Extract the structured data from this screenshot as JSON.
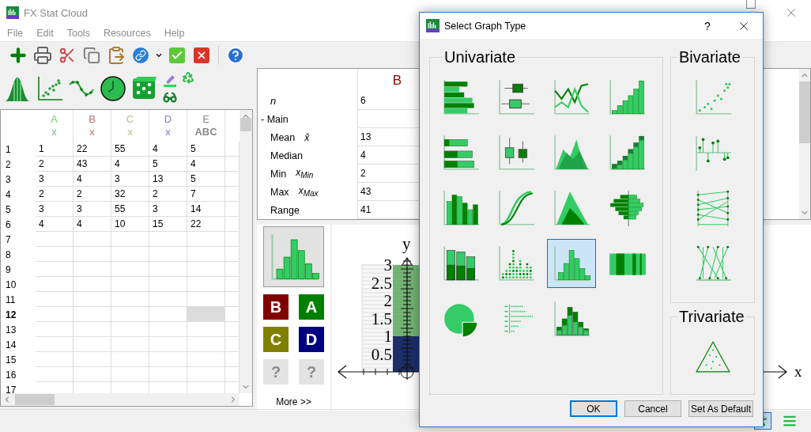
{
  "window": {
    "title": "FX Stat Cloud"
  },
  "menu": [
    "File",
    "Edit",
    "Tools",
    "Resources",
    "Help"
  ],
  "spreadsheet": {
    "columns": [
      {
        "letter": "A",
        "type": "x",
        "color": "#80c080"
      },
      {
        "letter": "B",
        "type": "x",
        "color": "#c07070"
      },
      {
        "letter": "C",
        "type": "x",
        "color": "#c0c080"
      },
      {
        "letter": "D",
        "type": "x",
        "color": "#8080c0"
      },
      {
        "letter": "E",
        "type": "ABC",
        "color": "#8a8a8a"
      }
    ],
    "rows": [
      {
        "label": "1",
        "current": false,
        "cells": [
          "1",
          "22",
          "55",
          "4",
          "5"
        ]
      },
      {
        "label": "2",
        "current": false,
        "cells": [
          "2",
          "43",
          "4",
          "5",
          "4"
        ]
      },
      {
        "label": "3",
        "current": false,
        "cells": [
          "3",
          "4",
          "3",
          "13",
          "5"
        ]
      },
      {
        "label": "4",
        "current": false,
        "cells": [
          "2",
          "2",
          "32",
          "2",
          "7"
        ]
      },
      {
        "label": "5",
        "current": false,
        "cells": [
          "3",
          "3",
          "55",
          "3",
          "14"
        ]
      },
      {
        "label": "6",
        "current": false,
        "cells": [
          "4",
          "4",
          "10",
          "15",
          "22"
        ]
      },
      {
        "label": "7",
        "current": false
      },
      {
        "label": "8",
        "current": false
      },
      {
        "label": "9",
        "current": false
      },
      {
        "label": "10",
        "current": false
      },
      {
        "label": "11",
        "current": false
      },
      {
        "label": "12",
        "current": true,
        "selected_cells": [
          false,
          false,
          false,
          false,
          true
        ]
      },
      {
        "label": "13",
        "current": false
      },
      {
        "label": "14",
        "current": false
      },
      {
        "label": "15",
        "current": false
      },
      {
        "label": "16",
        "current": false
      },
      {
        "label": "17",
        "current": false
      }
    ]
  },
  "statistics": {
    "column": "B",
    "rows": [
      {
        "kind": "symbol",
        "label": "n",
        "value": "6"
      },
      {
        "kind": "group",
        "label": "- Main"
      },
      {
        "kind": "stat",
        "label": "Mean",
        "symbol": "x̄",
        "value": "13"
      },
      {
        "kind": "stat",
        "label": "Median",
        "value": "4"
      },
      {
        "kind": "stat",
        "label": "Min",
        "symbol": "x$_{Min}$",
        "value": "2"
      },
      {
        "kind": "stat",
        "label": "Max",
        "symbol": "x$_{Max}$",
        "value": "43"
      },
      {
        "kind": "stat",
        "label": "Range",
        "value": "41"
      }
    ]
  },
  "graph_picker": {
    "variables": [
      {
        "label": "B",
        "color": "#800000",
        "disabled": false
      },
      {
        "label": "A",
        "color": "#008000",
        "disabled": false
      },
      {
        "label": "C",
        "color": "#808000",
        "disabled": false
      },
      {
        "label": "D",
        "color": "#000080",
        "disabled": false
      },
      {
        "label": "?",
        "disabled": true
      },
      {
        "label": "?",
        "disabled": true
      }
    ],
    "more_label": "More >>"
  },
  "graph": {
    "y_axis_label": "y",
    "x_axis_label": "x",
    "y_tick_labels": [
      "3",
      "2.5",
      "2",
      "1.5",
      "1",
      "0.5"
    ]
  },
  "status_bar": {
    "tools": [
      {
        "kind": "figure",
        "selected": true
      },
      {
        "kind": "list",
        "selected": false
      }
    ]
  },
  "dialog": {
    "title": "Select Graph Type",
    "help_label": "?",
    "groups": [
      {
        "title": "Univariate",
        "options": [
          {
            "kind": "hbar",
            "selected": false
          },
          {
            "kind": "boxplot",
            "selected": false
          },
          {
            "kind": "line",
            "selected": false
          },
          {
            "kind": "cumulative",
            "selected": false
          },
          {
            "kind": "stacked-hbar",
            "selected": false
          },
          {
            "kind": "boxplot-vertical",
            "selected": false
          },
          {
            "kind": "area",
            "selected": false
          },
          {
            "kind": "stacked-cumulative",
            "selected": false
          },
          {
            "kind": "bar",
            "selected": false
          },
          {
            "kind": "ogive",
            "selected": false
          },
          {
            "kind": "density",
            "selected": false
          },
          {
            "kind": "pyramid",
            "selected": false
          },
          {
            "kind": "stacked-bar",
            "selected": false
          },
          {
            "kind": "dotplot",
            "selected": false
          },
          {
            "kind": "histogram",
            "selected": true
          },
          {
            "kind": "strip",
            "selected": false
          },
          {
            "kind": "pie",
            "selected": false
          },
          {
            "kind": "stem-leaf",
            "selected": false
          },
          {
            "kind": "stacked-histogram",
            "selected": false
          }
        ]
      },
      {
        "title": "Bivariate",
        "options": [
          {
            "kind": "scatter",
            "selected": false
          },
          {
            "kind": "residual",
            "selected": false
          },
          {
            "kind": "parallel",
            "selected": false
          },
          {
            "kind": "parallel-crossed",
            "selected": false
          }
        ]
      },
      {
        "title": "Trivariate",
        "options": [
          {
            "kind": "ternary",
            "selected": false
          }
        ]
      }
    ],
    "buttons": [
      {
        "label": "OK",
        "default": true
      },
      {
        "label": "Cancel",
        "default": false
      },
      {
        "label": "Set As Default",
        "default": false
      }
    ]
  }
}
